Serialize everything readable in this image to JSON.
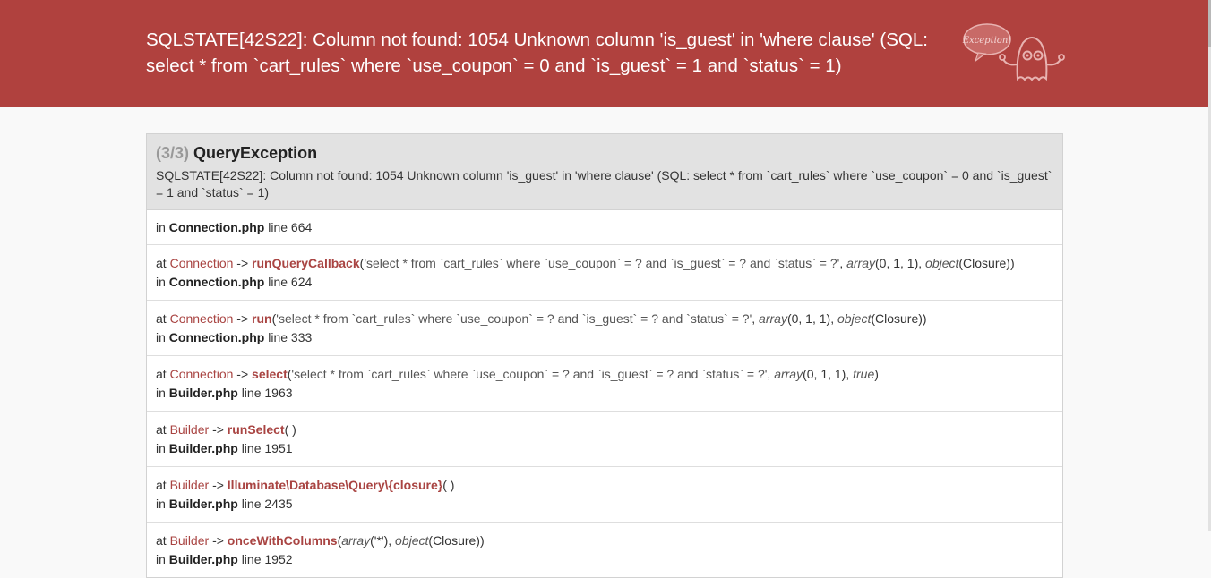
{
  "header": {
    "message": "SQLSTATE[42S22]: Column not found: 1054 Unknown column 'is_guest' in 'where clause' (SQL: select * from `cart_rules` where `use_coupon` = 0 and `is_guest` = 1 and `status` = 1)",
    "mascot_text": "Exception!"
  },
  "exception": {
    "count": "(3/3)",
    "title": "QueryException",
    "message": "SQLSTATE[42S22]: Column not found: 1054 Unknown column 'is_guest' in 'where clause' (SQL: select * from `cart_rules` where `use_coupon` = 0 and `is_guest` = 1 and `status` = 1)"
  },
  "labels": {
    "at": "at",
    "in": "in",
    "line": "line",
    "arrow": "->"
  },
  "trace": [
    {
      "file": "Connection.php",
      "line": "664"
    },
    {
      "class": "Connection",
      "method": "runQueryCallback",
      "args_str": "'select * from `cart_rules` where `use_coupon` = ? and `is_guest` = ? and `status` = ?'",
      "arg2_type": "array",
      "arg2_val": "(0, 1, 1)",
      "arg3_type": "object",
      "arg3_val": "(Closure)",
      "file": "Connection.php",
      "line": "624"
    },
    {
      "class": "Connection",
      "method": "run",
      "args_str": "'select * from `cart_rules` where `use_coupon` = ? and `is_guest` = ? and `status` = ?'",
      "arg2_type": "array",
      "arg2_val": "(0, 1, 1)",
      "arg3_type": "object",
      "arg3_val": "(Closure)",
      "file": "Connection.php",
      "line": "333"
    },
    {
      "class": "Connection",
      "method": "select",
      "args_str": "'select * from `cart_rules` where `use_coupon` = ? and `is_guest` = ? and `status` = ?'",
      "arg2_type": "array",
      "arg2_val": "(0, 1, 1)",
      "arg3_type": "true",
      "arg3_val": "",
      "file": "Builder.php",
      "line": "1963"
    },
    {
      "class": "Builder",
      "method": "runSelect",
      "file": "Builder.php",
      "line": "1951"
    },
    {
      "class": "Builder",
      "method": "Illuminate\\Database\\Query\\{closure}",
      "file": "Builder.php",
      "line": "2435"
    },
    {
      "class": "Builder",
      "method": "onceWithColumns",
      "arg1_type": "array",
      "arg1_val": "('*')",
      "arg3_type": "object",
      "arg3_val": "(Closure)",
      "file": "Builder.php",
      "line": "1952"
    }
  ]
}
